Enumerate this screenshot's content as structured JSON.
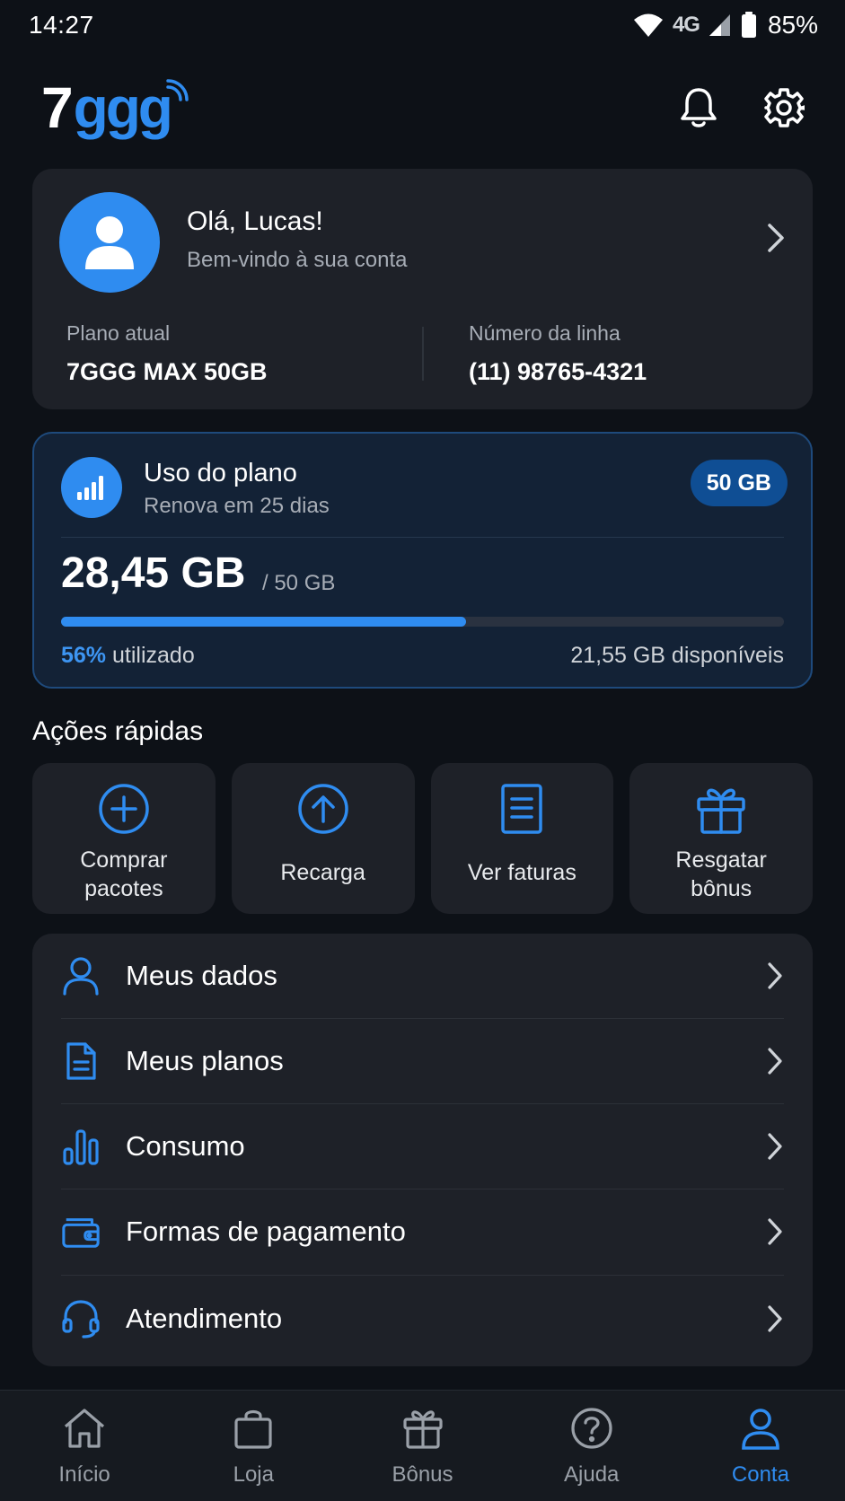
{
  "status_bar": {
    "time": "14:27",
    "network": "4G",
    "battery": "85%"
  },
  "header": {
    "logo_number": "7",
    "logo_text": "ggg",
    "icons": [
      "bell-icon",
      "gear-icon"
    ]
  },
  "profile": {
    "greeting": "Olá, Lucas!",
    "welcome": "Bem-vindo à sua conta",
    "plan_label": "Plano atual",
    "plan_value": "7GGG MAX 50GB",
    "line_label": "Número da linha",
    "line_value": "(11) 98765-4321"
  },
  "usage": {
    "title": "Uso do plano",
    "renew": "Renova em 25 dias",
    "badge": "50 GB",
    "used": "28,45 GB",
    "total": "/ 50 GB",
    "percent": "56%",
    "percent_label": "utilizado",
    "percent_value": 56,
    "available": "21,55 GB disponíveis"
  },
  "quick_actions": {
    "title": "Ações rápidas",
    "items": [
      {
        "label": "Comprar\npacotes",
        "icon": "plus-circle-icon"
      },
      {
        "label": "Recarga",
        "icon": "arrow-up-circle-icon"
      },
      {
        "label": "Ver faturas",
        "icon": "document-icon"
      },
      {
        "label": "Resgatar\nbônus",
        "icon": "gift-icon"
      }
    ]
  },
  "menu": {
    "items": [
      {
        "label": "Meus dados",
        "icon": "user-icon"
      },
      {
        "label": "Meus planos",
        "icon": "file-icon"
      },
      {
        "label": "Consumo",
        "icon": "bar-chart-icon"
      },
      {
        "label": "Formas de pagamento",
        "icon": "wallet-icon"
      },
      {
        "label": "Atendimento",
        "icon": "headset-icon"
      }
    ]
  },
  "bottom_nav": {
    "items": [
      {
        "label": "Início",
        "icon": "home-icon"
      },
      {
        "label": "Loja",
        "icon": "shopping-bag-icon"
      },
      {
        "label": "Bônus",
        "icon": "gift-icon"
      },
      {
        "label": "Ajuda",
        "icon": "help-circle-icon"
      },
      {
        "label": "Conta",
        "icon": "user-icon"
      }
    ],
    "active": "Conta"
  },
  "colors": {
    "background": "#0d1117",
    "card": "#1e2128",
    "accent": "#2f8cf0",
    "usage_card": "#132236"
  }
}
